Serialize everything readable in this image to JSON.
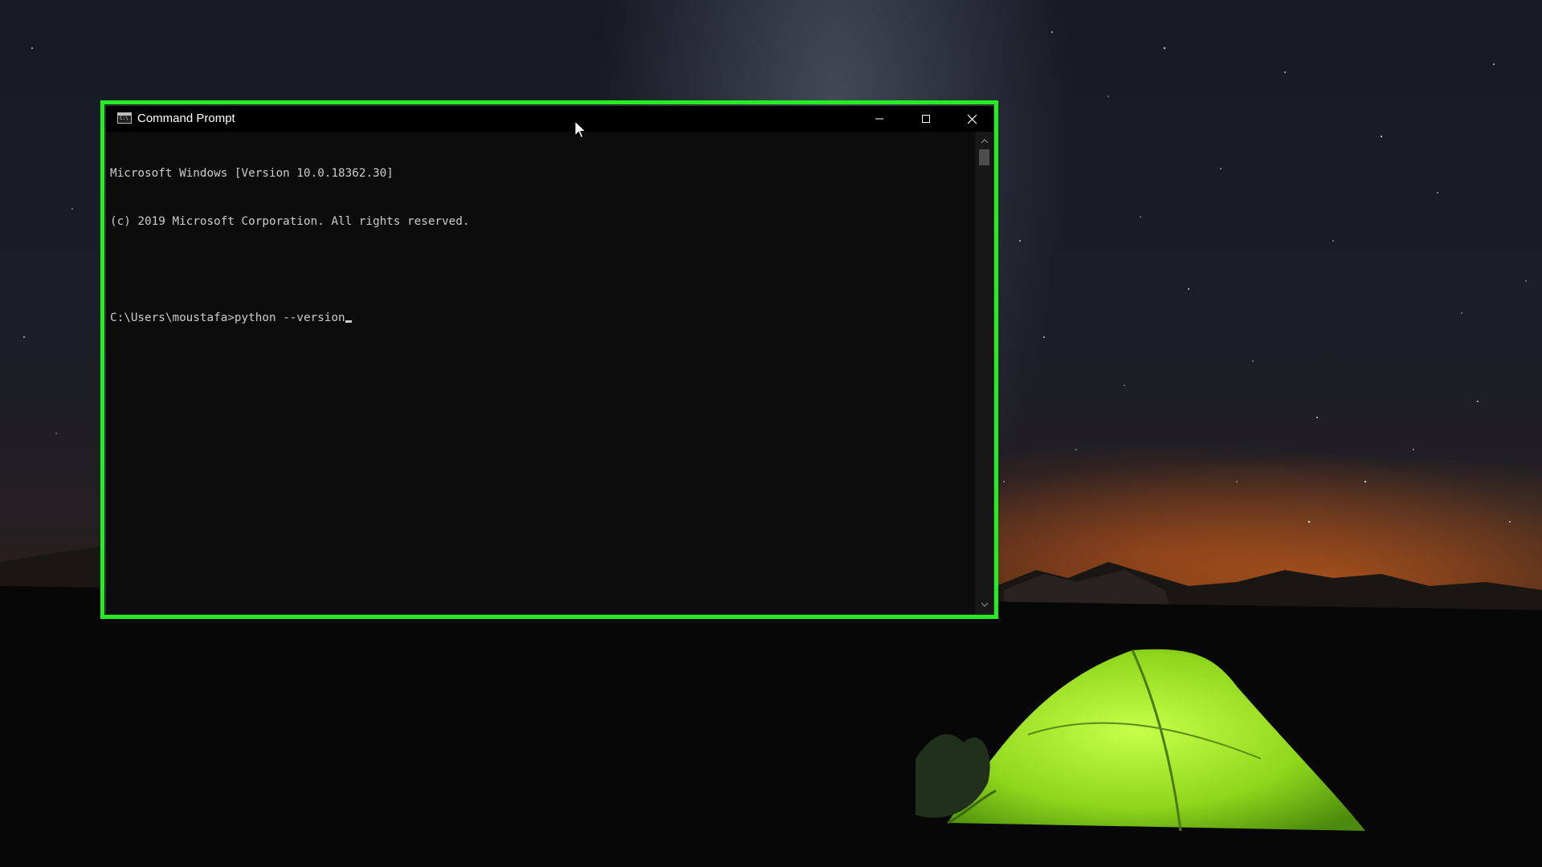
{
  "window": {
    "title": "Command Prompt",
    "app_icon": "cmd-icon",
    "controls": [
      "minimize-icon",
      "maximize-icon",
      "close-icon"
    ]
  },
  "console": {
    "lines": [
      "Microsoft Windows [Version 10.0.18362.30]",
      "(c) 2019 Microsoft Corporation. All rights reserved.",
      "",
      "C:\\Users\\moustafa>python --version"
    ]
  },
  "scrollbar": {
    "icons": [
      "chevron-up-icon",
      "chevron-down-icon"
    ]
  },
  "desktop": {
    "wallpaper": "night-sky-with-green-tent",
    "highlight_color": "#22ee22"
  },
  "colors": {
    "console_background": "#0c0c0c",
    "console_text": "#cccccc",
    "title_bar": "#000000"
  }
}
